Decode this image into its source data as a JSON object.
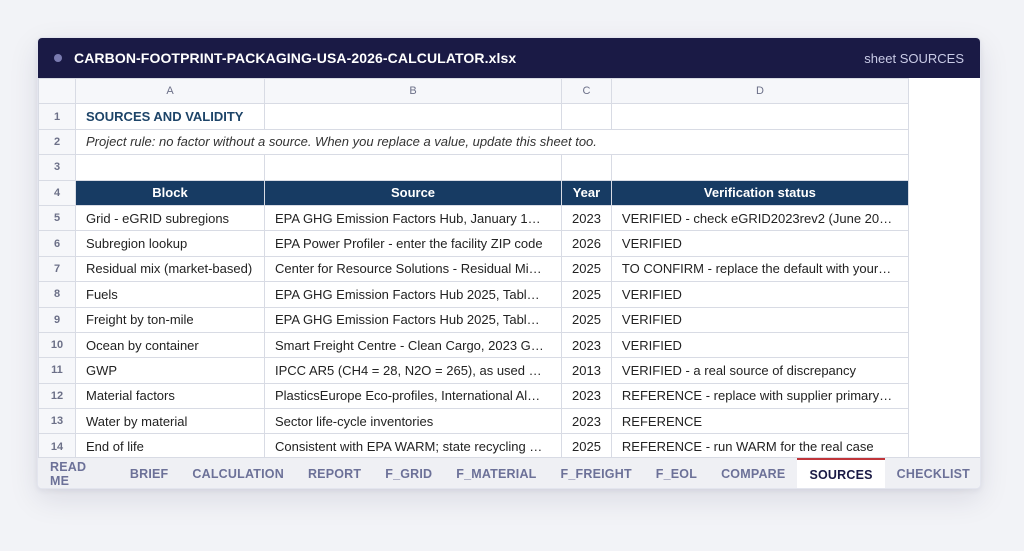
{
  "window": {
    "title": "CARBON-FOOTPRINT-PACKAGING-USA-2026-CALCULATOR.xlsx",
    "sheet_label": "sheet SOURCES"
  },
  "columns": [
    "A",
    "B",
    "C",
    "D"
  ],
  "rows": {
    "r1": {
      "num": "1",
      "a": "SOURCES AND VALIDITY"
    },
    "r2": {
      "num": "2",
      "a": "Project rule: no factor without a source. When you replace a value, update this sheet too."
    },
    "r3": {
      "num": "3"
    },
    "r4": {
      "num": "4",
      "a": "Block",
      "b": "Source",
      "c": "Year",
      "d": "Verification status"
    }
  },
  "data_rows": [
    {
      "num": "5",
      "block": "Grid - eGRID subregions",
      "source": "EPA GHG Emission Factors Hub, January 1…",
      "year": "2023",
      "status": "VERIFIED - check eGRID2023rev2 (June 20…"
    },
    {
      "num": "6",
      "block": "Subregion lookup",
      "source": "EPA Power Profiler - enter the facility ZIP code",
      "year": "2026",
      "status": "VERIFIED"
    },
    {
      "num": "7",
      "block": "Residual mix (market-based)",
      "source": "Center for Resource Solutions - Residual Mi…",
      "year": "2025",
      "status": "TO CONFIRM - replace the default with your…"
    },
    {
      "num": "8",
      "block": "Fuels",
      "source": "EPA GHG Emission Factors Hub 2025, Tabl…",
      "year": "2025",
      "status": "VERIFIED"
    },
    {
      "num": "9",
      "block": "Freight by ton-mile",
      "source": "EPA GHG Emission Factors Hub 2025, Tabl…",
      "year": "2025",
      "status": "VERIFIED"
    },
    {
      "num": "10",
      "block": "Ocean by container",
      "source": "Smart Freight Centre - Clean Cargo, 2023 G…",
      "year": "2023",
      "status": "VERIFIED"
    },
    {
      "num": "11",
      "block": "GWP",
      "source": "IPCC AR5 (CH4 = 28, N2O = 265), as used …",
      "year": "2013",
      "status": "VERIFIED - a real source of discrepancy"
    },
    {
      "num": "12",
      "block": "Material factors",
      "source": "PlasticsEurope Eco-profiles, International Al…",
      "year": "2023",
      "status": "REFERENCE - replace with supplier primary…"
    },
    {
      "num": "13",
      "block": "Water by material",
      "source": "Sector life-cycle inventories",
      "year": "2023",
      "status": "REFERENCE"
    },
    {
      "num": "14",
      "block": "End of life",
      "source": "Consistent with EPA WARM; state recycling …",
      "year": "2025",
      "status": "REFERENCE - run WARM for the real case"
    }
  ],
  "tabs": [
    "READ ME",
    "BRIEF",
    "CALCULATION",
    "REPORT",
    "F_GRID",
    "F_MATERIAL",
    "F_FREIGHT",
    "F_EOL",
    "COMPARE",
    "SOURCES",
    "CHECKLIST"
  ],
  "active_tab": "SOURCES",
  "colors": {
    "titlebar": "#1a1a45",
    "header_fill": "#173b63",
    "title_text": "#1d4468",
    "active_tab_accent": "#c0353a"
  }
}
